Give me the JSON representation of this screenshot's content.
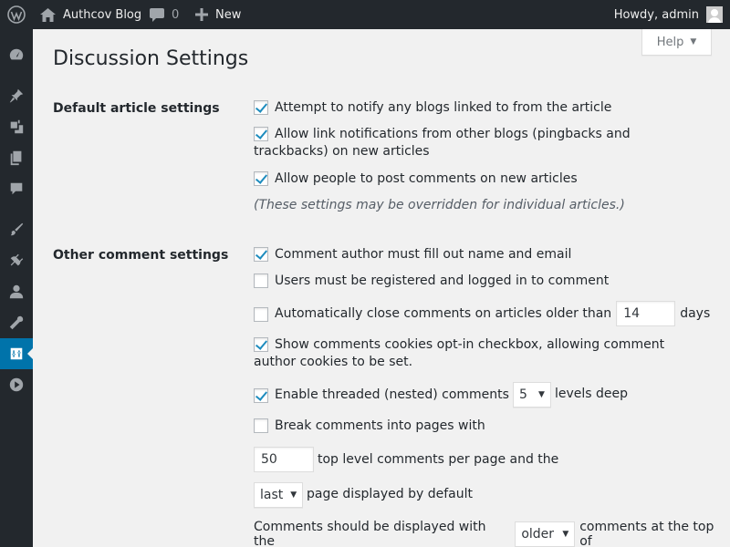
{
  "adminbar": {
    "site_name": "Authcov Blog",
    "comments_count": "0",
    "new_label": "New",
    "account_greeting": "Howdy, admin"
  },
  "help": {
    "label": "Help"
  },
  "page_title": "Discussion Settings",
  "default_article": {
    "label": "Default article settings",
    "options": [
      {
        "label": "Attempt to notify any blogs linked to from the article",
        "checked": true
      },
      {
        "label": "Allow link notifications from other blogs (pingbacks and trackbacks) on new articles",
        "checked": true
      },
      {
        "label": "Allow people to post comments on new articles",
        "checked": true
      }
    ],
    "note": "(These settings may be overridden for individual articles.)"
  },
  "other_comment": {
    "label": "Other comment settings",
    "require_name_email": {
      "label": "Comment author must fill out name and email",
      "checked": true
    },
    "registration_required": {
      "label": "Users must be registered and logged in to comment",
      "checked": false
    },
    "auto_close": {
      "label": "Automatically close comments on articles older than",
      "checked": false,
      "days_value": "14",
      "days_suffix": "days"
    },
    "cookies_opt_in": {
      "label": "Show comments cookies opt-in checkbox, allowing comment author cookies to be set.",
      "checked": true
    },
    "threaded": {
      "label": "Enable threaded (nested) comments",
      "checked": true,
      "depth_value": "5",
      "depth_suffix": "levels deep"
    },
    "paginate": {
      "label": "Break comments into pages with",
      "checked": false
    },
    "per_page": {
      "value": "50",
      "suffix": "top level comments per page and the"
    },
    "default_page": {
      "value": "last",
      "suffix": "page displayed by default"
    },
    "order": {
      "prefix": "Comments should be displayed with the",
      "value": "older",
      "suffix": "comments at the top of"
    }
  },
  "colors": {
    "adminbar_bg": "#23282d",
    "sidebar_current": "#0073aa",
    "checkmark": "#1e8cbe",
    "content_bg": "#f1f1f1"
  }
}
